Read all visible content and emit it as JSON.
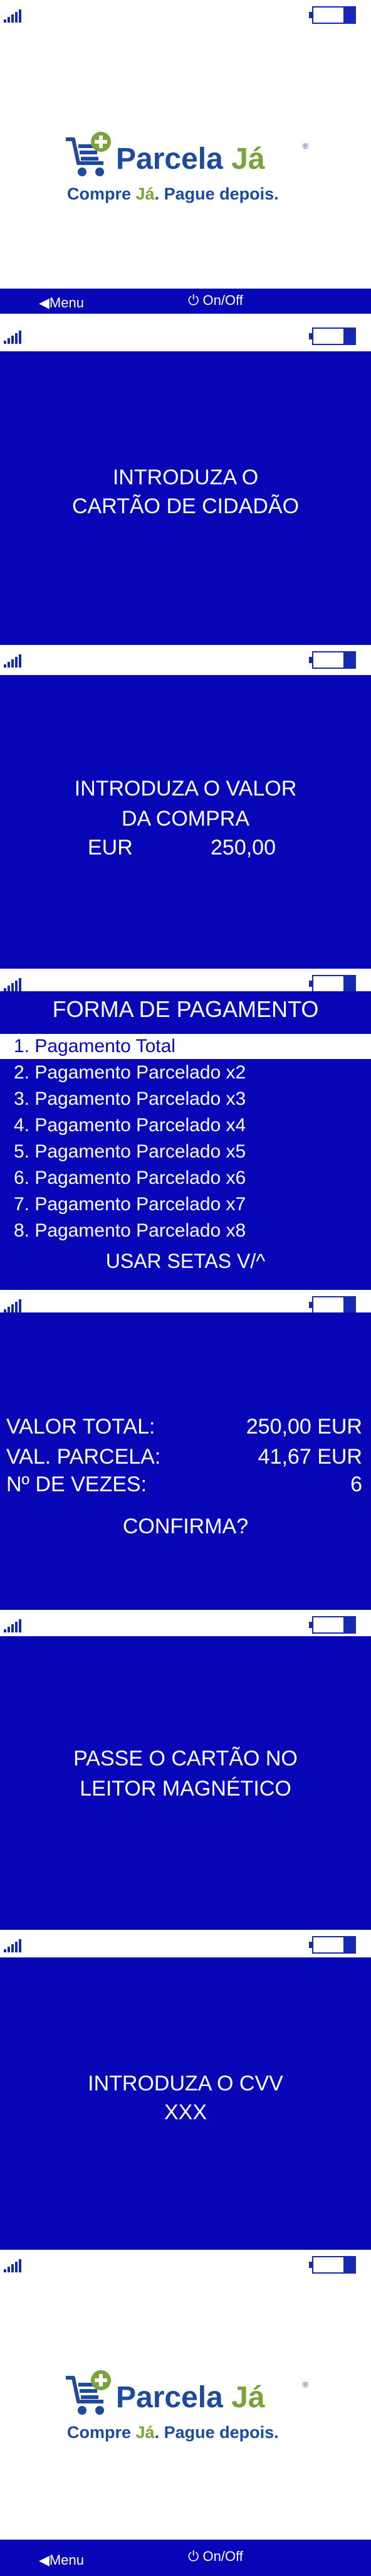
{
  "brand": {
    "name_part1": "Parcela ",
    "name_part2": "Já",
    "registered": "®",
    "tagline_part1": "Compre ",
    "tagline_part2": "Já",
    "tagline_part3": ". Pague depois."
  },
  "navigation": {
    "menu_label": "◀Menu",
    "onoff_label": "⏻ On/Off"
  },
  "screen_card": {
    "line1": "INTRODUZA O",
    "line2": "CARTÃO DE CIDADÃO"
  },
  "screen_amount": {
    "line1": "INTRODUZA O VALOR",
    "line2": "DA COMPRA",
    "currency": "EUR",
    "amount": "250,00"
  },
  "screen_payment": {
    "title": "FORMA DE PAGAMENTO",
    "options": [
      "1. Pagamento Total",
      "2. Pagamento Parcelado x2",
      "3. Pagamento Parcelado x3",
      "4. Pagamento Parcelado x4",
      "5. Pagamento Parcelado x5",
      "6. Pagamento Parcelado x6",
      "7. Pagamento Parcelado x7",
      "8. Pagamento Parcelado x8"
    ],
    "hint": "USAR SETAS V/^"
  },
  "screen_confirm": {
    "total_label": "VALOR  TOTAL:",
    "total_value": "250,00 EUR",
    "installment_label": "VAL. PARCELA:",
    "installment_value": "41,67 EUR",
    "times_label": "Nº DE VEZES:",
    "times_value": "6",
    "question": "CONFIRMA?"
  },
  "screen_swipe": {
    "line1": "PASSE O CARTÃO NO",
    "line2": "LEITOR MAGNÉTICO"
  },
  "screen_cvv": {
    "line1": "INTRODUZA O CVV",
    "line2": "XXX"
  },
  "colors": {
    "screen_blue": "#0707b8",
    "brand_blue": "#1c4a9e",
    "brand_green": "#7aa33a"
  }
}
